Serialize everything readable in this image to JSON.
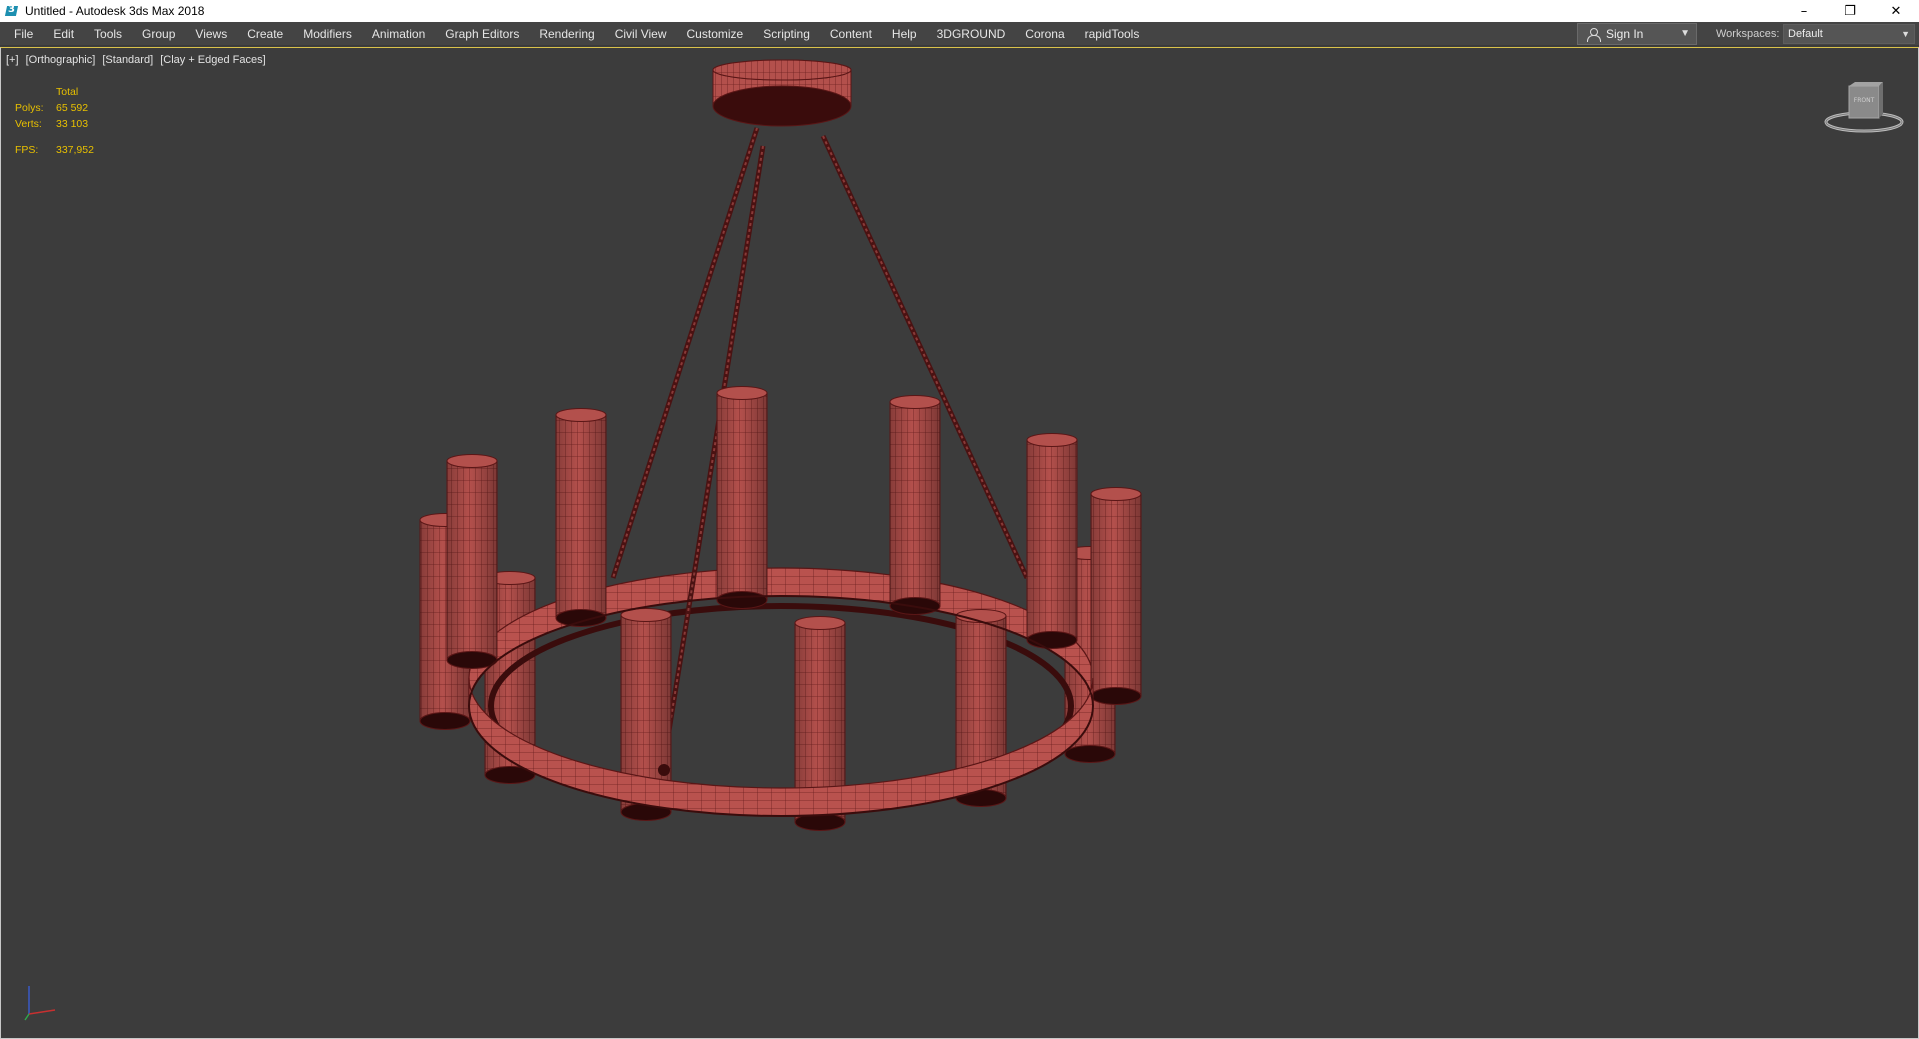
{
  "window": {
    "title": "Untitled - Autodesk 3ds Max 2018",
    "controls": {
      "minimize": "–",
      "restore": "❐",
      "close": "✕"
    }
  },
  "menu": {
    "items": [
      "File",
      "Edit",
      "Tools",
      "Group",
      "Views",
      "Create",
      "Modifiers",
      "Animation",
      "Graph Editors",
      "Rendering",
      "Civil View",
      "Customize",
      "Scripting",
      "Content",
      "Help",
      "3DGROUND",
      "Corona",
      "rapidTools"
    ],
    "sign_in": "Sign In",
    "workspaces_label": "Workspaces:",
    "workspaces_value": "Default"
  },
  "viewport": {
    "label_parts": [
      "[+]",
      "[Orthographic]",
      "[Standard]",
      "[Clay + Edged Faces]"
    ],
    "stats": {
      "header": "Total",
      "polys_label": "Polys:",
      "polys_value": "65 592",
      "verts_label": "Verts:",
      "verts_value": "33 103",
      "fps_label": "FPS:",
      "fps_value": "337,952"
    },
    "viewcube_face": "FRONT",
    "model_color": "#b04a47",
    "background_color": "#3c3c3c"
  },
  "colors": {
    "stats_text": "#e8c000",
    "menubar_bg": "#444444",
    "titlebar_bg": "#ffffff",
    "viewport_border_active": "#d9c24a"
  }
}
